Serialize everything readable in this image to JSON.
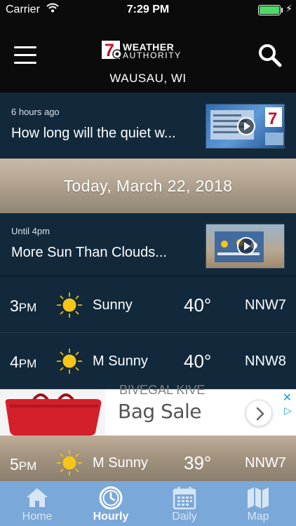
{
  "status_bar": {
    "carrier": "Carrier",
    "time": "7:29 PM"
  },
  "header": {
    "logo_number": "7",
    "logo_line1": "WEATHER",
    "logo_line2": "AUTHORITY",
    "location": "WAUSAU, WI"
  },
  "stories": [
    {
      "meta": "6 hours ago",
      "headline": "How long will the quiet w...",
      "thumb_icon": "video-play-icon"
    },
    {
      "meta": "Until 4pm",
      "headline": "More Sun Than Clouds...",
      "thumb_icon": "video-play-icon"
    }
  ],
  "date_banner": "Today, March 22, 2018",
  "hourly": [
    {
      "hour": "3",
      "ampm": "PM",
      "icon": "sun-icon",
      "condition": "Sunny",
      "temp": "40°",
      "wind": "NNW7"
    },
    {
      "hour": "4",
      "ampm": "PM",
      "icon": "sun-icon",
      "condition": "M Sunny",
      "temp": "40°",
      "wind": "NNW8"
    },
    {
      "hour": "5",
      "ampm": "PM",
      "icon": "sun-icon",
      "condition": "M Sunny",
      "temp": "39°",
      "wind": "NNW7"
    }
  ],
  "ad": {
    "text": "Bag Sale",
    "cut_text": "BIVEGAL KIVE"
  },
  "tabs": [
    {
      "label": "Home",
      "icon": "home-icon",
      "active": false
    },
    {
      "label": "Hourly",
      "icon": "clock-icon",
      "active": true
    },
    {
      "label": "Daily",
      "icon": "calendar-icon",
      "active": false
    },
    {
      "label": "Map",
      "icon": "map-icon",
      "active": false
    }
  ],
  "colors": {
    "accent": "#7aa8d8",
    "row_bg": "#12293c",
    "sun": "#f5c518",
    "battery": "#4cd964"
  }
}
